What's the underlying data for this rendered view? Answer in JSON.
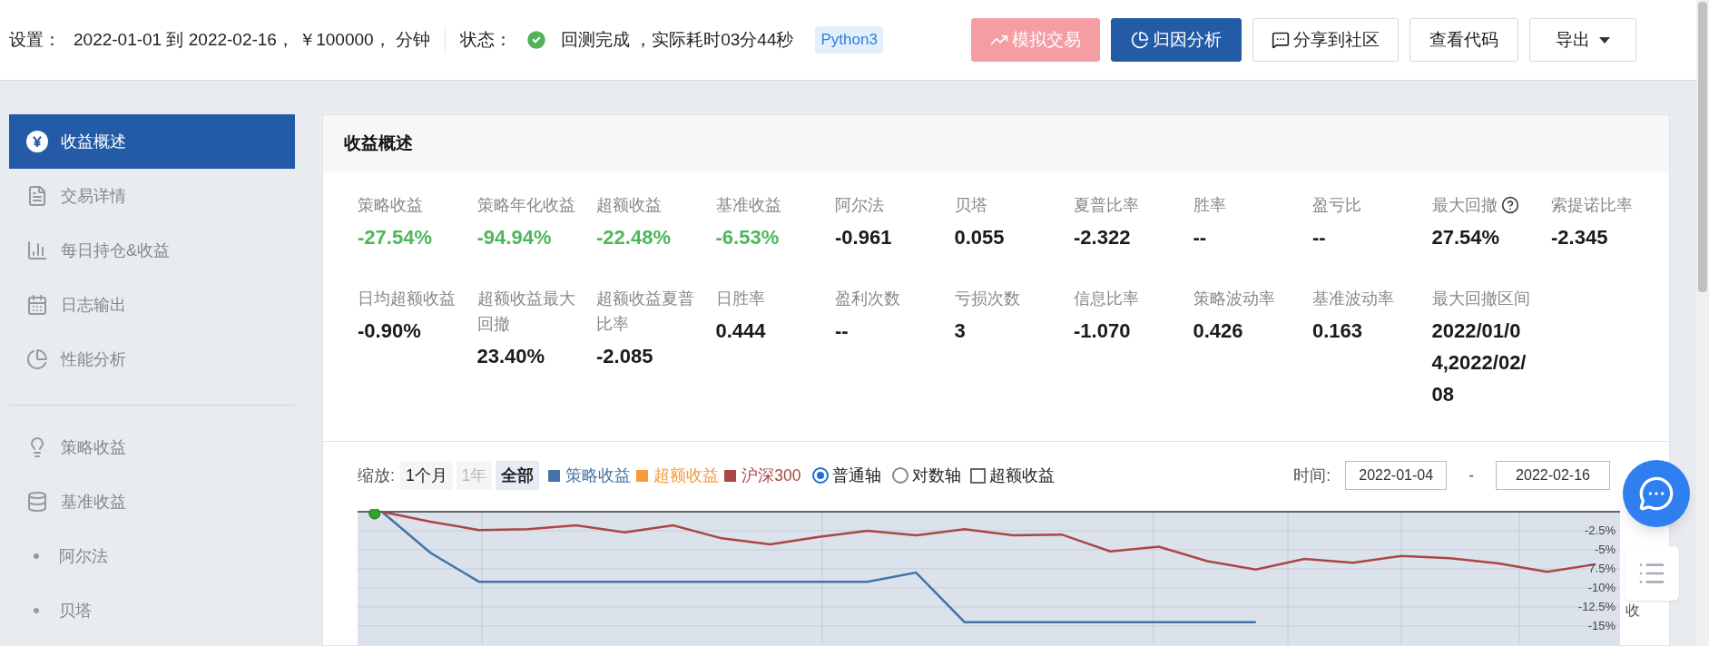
{
  "header": {
    "settings_label": "设置：",
    "settings_value": "2022-01-01 到 2022-02-16， ￥100000， 分钟",
    "status_label": "状态：",
    "status_done": true,
    "status_text": "回测完成 ，实际耗时03分44秒",
    "language_badge": "Python3",
    "buttons": [
      {
        "label": "模拟交易",
        "kind": "disabled"
      },
      {
        "label": "归因分析",
        "kind": "primary"
      },
      {
        "label": "分享到社区",
        "kind": "outline"
      },
      {
        "label": "查看代码",
        "kind": "outline"
      },
      {
        "label": "导出",
        "kind": "dropdown"
      }
    ]
  },
  "sidebar": {
    "groups": [
      {
        "items": [
          {
            "label": "收益概述",
            "kind": "icon",
            "selected": true
          },
          {
            "label": "交易详情",
            "kind": "icon",
            "selected": false
          },
          {
            "label": "每日持仓&收益",
            "kind": "icon",
            "selected": false
          },
          {
            "label": "日志输出",
            "kind": "icon",
            "selected": false
          },
          {
            "label": "性能分析",
            "kind": "icon",
            "selected": false
          }
        ]
      },
      {
        "items": [
          {
            "label": "策略收益",
            "kind": "icon",
            "selected": false
          },
          {
            "label": "基准收益",
            "kind": "icon",
            "selected": false
          },
          {
            "label": "阿尔法",
            "kind": "bullet",
            "selected": false
          },
          {
            "label": "贝塔",
            "kind": "bullet",
            "selected": false
          }
        ]
      }
    ]
  },
  "panel": {
    "title": "收益概述",
    "metric_rows": [
      [
        {
          "label": "策略收益",
          "value": "-27.54%",
          "color": "#4cb85a"
        },
        {
          "label": "策略年化收益",
          "value": "-94.94%",
          "color": "#4cb85a"
        },
        {
          "label": "超额收益",
          "value": "-22.48%",
          "color": "#4cb85a"
        },
        {
          "label": "基准收益",
          "value": "-6.53%",
          "color": "#4cb85a"
        },
        {
          "label": "阿尔法",
          "value": "-0.961",
          "color": "#1a1a1a"
        },
        {
          "label": "贝塔",
          "value": "0.055",
          "color": "#1a1a1a"
        },
        {
          "label": "夏普比率",
          "value": "-2.322",
          "color": "#1a1a1a"
        },
        {
          "label": "胜率",
          "value": "--",
          "color": "#1a1a1a"
        },
        {
          "label": "盈亏比",
          "value": "--",
          "color": "#1a1a1a"
        },
        {
          "label": "最大回撤",
          "value": "27.54%",
          "color": "#1a1a1a",
          "help": true
        },
        {
          "label": "索提诺比率",
          "value": "-2.345",
          "color": "#1a1a1a"
        }
      ],
      [
        {
          "label": "日均超额收益",
          "value": "-0.90%",
          "color": "#1a1a1a"
        },
        {
          "label": "超额收益最大回撤",
          "value": "23.40%",
          "color": "#1a1a1a"
        },
        {
          "label": "超额收益夏普比率",
          "value": "-2.085",
          "color": "#1a1a1a"
        },
        {
          "label": "日胜率",
          "value": "0.444",
          "color": "#1a1a1a"
        },
        {
          "label": "盈利次数",
          "value": "--",
          "color": "#1a1a1a"
        },
        {
          "label": "亏损次数",
          "value": "3",
          "color": "#1a1a1a"
        },
        {
          "label": "信息比率",
          "value": "-1.070",
          "color": "#1a1a1a"
        },
        {
          "label": "策略波动率",
          "value": "0.426",
          "color": "#1a1a1a"
        },
        {
          "label": "基准波动率",
          "value": "0.163",
          "color": "#1a1a1a"
        },
        {
          "label": "最大回撤区间",
          "value": "2022/01/04,2022/02/08",
          "color": "#1a1a1a"
        }
      ]
    ],
    "chart_toolbar": {
      "zoom_label": "缩放:",
      "zoom_options": [
        {
          "label": "1个月",
          "disabled": false,
          "selected": false
        },
        {
          "label": "1年",
          "disabled": true,
          "selected": false
        },
        {
          "label": "全部",
          "disabled": false,
          "selected": true
        }
      ],
      "axis_options": [
        {
          "label": "普通轴",
          "selected": true
        },
        {
          "label": "对数轴",
          "selected": false
        }
      ],
      "excess_checkbox": {
        "label": "超额收益",
        "checked": false
      },
      "time_label": "时间:",
      "date_from": "2022-01-04",
      "date_separator": "-",
      "date_to": "2022-02-16"
    },
    "chart_data": {
      "type": "line",
      "grid": true,
      "ylabel": "收",
      "categories": [
        null,
        null,
        null,
        null,
        null,
        null,
        null,
        null,
        null,
        null,
        null,
        null,
        null,
        null,
        null,
        null,
        null,
        null,
        null,
        null,
        null,
        null,
        null,
        null,
        null,
        null
      ],
      "ylim": [
        -18,
        0
      ],
      "yticks": [
        {
          "value": -2.5,
          "label": "-2.5%"
        },
        {
          "value": -5,
          "label": "-5%"
        },
        {
          "value": -7.5,
          "label": "7.5%"
        },
        {
          "value": -10,
          "label": "-10%"
        },
        {
          "value": -12.5,
          "label": "-12.5%"
        },
        {
          "value": -15,
          "label": "-15%"
        }
      ],
      "series": [
        {
          "name": "策略收益",
          "color": "#4572a7",
          "values": [
            0,
            -5.4,
            -9.2,
            -9.2,
            -9.2,
            -9.2,
            -9.2,
            -9.2,
            -9.2,
            -9.2,
            -9.2,
            -8,
            -14.5,
            -14.5,
            -14.5,
            -14.5,
            -14.5,
            -14.5,
            -14.5,
            null,
            null,
            null,
            null,
            null,
            null,
            null
          ]
        },
        {
          "name": "超额收益",
          "color": "#f79a3b",
          "values": [
            null,
            null,
            null,
            null,
            null,
            null,
            null,
            null,
            null,
            null,
            null,
            null,
            null,
            null,
            null,
            null,
            null,
            null,
            null,
            null,
            null,
            null,
            null,
            null,
            null,
            null
          ]
        },
        {
          "name": "沪深300",
          "color": "#aa4643",
          "values": [
            0,
            -1.3,
            -2.4,
            -2.3,
            -1.8,
            -2.7,
            -1.8,
            -3.5,
            -4.3,
            -3.3,
            -2.5,
            -3.1,
            -2.3,
            -3.1,
            -3,
            -5.2,
            -4.6,
            -6.5,
            -7.6,
            -6.2,
            -6.7,
            -5.8,
            -6.1,
            -6.8,
            -7.9,
            -6.9
          ]
        }
      ]
    }
  }
}
